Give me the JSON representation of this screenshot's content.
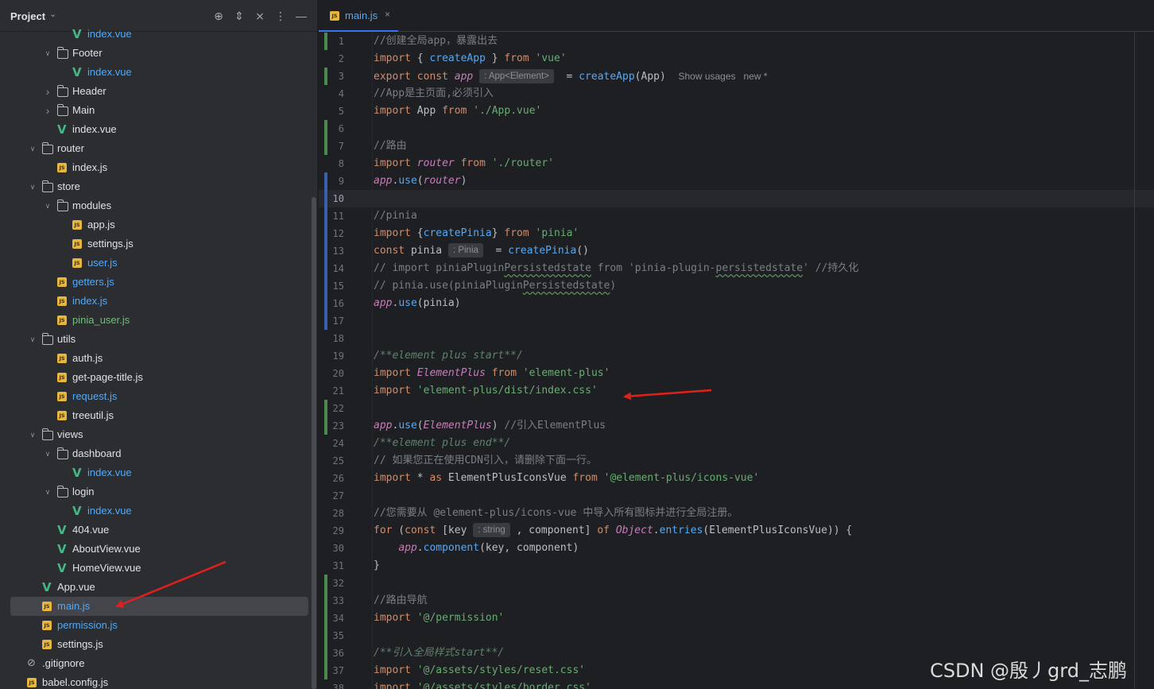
{
  "project_panel": {
    "title": "Project",
    "toolbar": [
      "locate-icon",
      "expand-collapse-icon",
      "collapse-all-icon",
      "more-icon",
      "minimize-icon"
    ],
    "tree": [
      {
        "label": "index.vue",
        "type": "vue",
        "indent": 5,
        "color": "blue"
      },
      {
        "label": "Footer",
        "type": "folder",
        "indent": 4,
        "expanded": true
      },
      {
        "label": "index.vue",
        "type": "vue",
        "indent": 5,
        "color": "blue"
      },
      {
        "label": "Header",
        "type": "folder",
        "indent": 4,
        "expanded": false
      },
      {
        "label": "Main",
        "type": "folder",
        "indent": 4,
        "expanded": false
      },
      {
        "label": "index.vue",
        "type": "vue",
        "indent": 4,
        "color": "default"
      },
      {
        "label": "router",
        "type": "folder",
        "indent": 3,
        "expanded": true
      },
      {
        "label": "index.js",
        "type": "js",
        "indent": 4,
        "color": "default"
      },
      {
        "label": "store",
        "type": "folder",
        "indent": 3,
        "expanded": true
      },
      {
        "label": "modules",
        "type": "folder",
        "indent": 4,
        "expanded": true
      },
      {
        "label": "app.js",
        "type": "js",
        "indent": 5,
        "color": "default"
      },
      {
        "label": "settings.js",
        "type": "js",
        "indent": 5,
        "color": "default"
      },
      {
        "label": "user.js",
        "type": "js",
        "indent": 5,
        "color": "blue"
      },
      {
        "label": "getters.js",
        "type": "js",
        "indent": 4,
        "color": "blue"
      },
      {
        "label": "index.js",
        "type": "js",
        "indent": 4,
        "color": "blue"
      },
      {
        "label": "pinia_user.js",
        "type": "js",
        "indent": 4,
        "color": "green"
      },
      {
        "label": "utils",
        "type": "folder",
        "indent": 3,
        "expanded": true
      },
      {
        "label": "auth.js",
        "type": "js",
        "indent": 4,
        "color": "default"
      },
      {
        "label": "get-page-title.js",
        "type": "js",
        "indent": 4,
        "color": "default"
      },
      {
        "label": "request.js",
        "type": "js",
        "indent": 4,
        "color": "blue"
      },
      {
        "label": "treeutil.js",
        "type": "js",
        "indent": 4,
        "color": "default"
      },
      {
        "label": "views",
        "type": "folder",
        "indent": 3,
        "expanded": true
      },
      {
        "label": "dashboard",
        "type": "folder",
        "indent": 4,
        "expanded": true
      },
      {
        "label": "index.vue",
        "type": "vue",
        "indent": 5,
        "color": "blue"
      },
      {
        "label": "login",
        "type": "folder",
        "indent": 4,
        "expanded": true
      },
      {
        "label": "index.vue",
        "type": "vue",
        "indent": 5,
        "color": "blue"
      },
      {
        "label": "404.vue",
        "type": "vue",
        "indent": 4,
        "color": "default"
      },
      {
        "label": "AboutView.vue",
        "type": "vue",
        "indent": 4,
        "color": "default"
      },
      {
        "label": "HomeView.vue",
        "type": "vue",
        "indent": 4,
        "color": "default"
      },
      {
        "label": "App.vue",
        "type": "vue",
        "indent": 3,
        "color": "default"
      },
      {
        "label": "main.js",
        "type": "js",
        "indent": 3,
        "color": "blue",
        "selected": true
      },
      {
        "label": "permission.js",
        "type": "js",
        "indent": 3,
        "color": "blue"
      },
      {
        "label": "settings.js",
        "type": "js",
        "indent": 3,
        "color": "default"
      },
      {
        "label": ".gitignore",
        "type": "ignore",
        "indent": 2,
        "color": "default"
      },
      {
        "label": "babel.config.js",
        "type": "js",
        "indent": 2,
        "color": "default"
      }
    ]
  },
  "editor": {
    "tab": {
      "label": "main.js",
      "icon": "js-file-icon",
      "close": "×"
    },
    "current_line": 10,
    "lines": [
      [
        [
          "cmt",
          "//创建全局app，暴露出去"
        ]
      ],
      [
        [
          "kw",
          "import"
        ],
        [
          "dim",
          " { "
        ],
        [
          "fn",
          "createApp"
        ],
        [
          "dim",
          " } "
        ],
        [
          "kw",
          "from"
        ],
        [
          "dim",
          " "
        ],
        [
          "str",
          "'vue'"
        ]
      ],
      [
        [
          "kw",
          "export const"
        ],
        [
          "dim",
          " "
        ],
        [
          "glob",
          "app"
        ],
        [
          "dim",
          " "
        ],
        [
          "hint",
          ": App<Element>"
        ],
        [
          "dim",
          "  = "
        ],
        [
          "fn",
          "createApp"
        ],
        [
          "dim",
          "(App)  "
        ],
        [
          "usage",
          "Show usages   new *"
        ]
      ],
      [
        [
          "cmt",
          "//App是主页面,必须引入"
        ]
      ],
      [
        [
          "kw",
          "import"
        ],
        [
          "dim",
          " App "
        ],
        [
          "kw",
          "from"
        ],
        [
          "dim",
          " "
        ],
        [
          "str",
          "'./App.vue'"
        ]
      ],
      [],
      [
        [
          "cmt",
          "//路由"
        ]
      ],
      [
        [
          "kw",
          "import"
        ],
        [
          "dim",
          " "
        ],
        [
          "glob",
          "router"
        ],
        [
          "dim",
          " "
        ],
        [
          "kw",
          "from"
        ],
        [
          "dim",
          " "
        ],
        [
          "str",
          "'./router'"
        ]
      ],
      [
        [
          "glob",
          "app"
        ],
        [
          "dim",
          "."
        ],
        [
          "fn",
          "use"
        ],
        [
          "dim",
          "("
        ],
        [
          "glob",
          "router"
        ],
        [
          "dim",
          ")"
        ]
      ],
      [],
      [
        [
          "cmt",
          "//pinia"
        ]
      ],
      [
        [
          "kw",
          "import"
        ],
        [
          "dim",
          " {"
        ],
        [
          "fn",
          "createPinia"
        ],
        [
          "dim",
          "} "
        ],
        [
          "kw",
          "from"
        ],
        [
          "dim",
          " "
        ],
        [
          "str",
          "'pinia'"
        ]
      ],
      [
        [
          "kw",
          "const"
        ],
        [
          "dim",
          " pinia "
        ],
        [
          "hint",
          ": Pinia"
        ],
        [
          "dim",
          "  = "
        ],
        [
          "fn",
          "createPinia"
        ],
        [
          "dim",
          "()"
        ]
      ],
      [
        [
          "cmt",
          "// import piniaPlugin"
        ],
        [
          "cmtw",
          "Persistedstate"
        ],
        [
          "cmt",
          " from 'pinia-plugin-"
        ],
        [
          "cmtw",
          "persistedstate"
        ],
        [
          "cmt",
          "' //持久化"
        ]
      ],
      [
        [
          "cmt",
          "// pinia.use(piniaPlugin"
        ],
        [
          "cmtw",
          "Persistedstate"
        ],
        [
          "cmt",
          ")"
        ]
      ],
      [
        [
          "glob",
          "app"
        ],
        [
          "dim",
          "."
        ],
        [
          "fn",
          "use"
        ],
        [
          "dim",
          "(pinia)"
        ]
      ],
      [],
      [],
      [
        [
          "doc",
          "/**element plus start**/"
        ]
      ],
      [
        [
          "kw",
          "import"
        ],
        [
          "dim",
          " "
        ],
        [
          "cls",
          "ElementPlus"
        ],
        [
          "dim",
          " "
        ],
        [
          "kw",
          "from"
        ],
        [
          "dim",
          " "
        ],
        [
          "str",
          "'element-plus'"
        ]
      ],
      [
        [
          "kw",
          "import"
        ],
        [
          "dim",
          " "
        ],
        [
          "str",
          "'element-plus/dist/index.css'"
        ]
      ],
      [],
      [
        [
          "glob",
          "app"
        ],
        [
          "dim",
          "."
        ],
        [
          "fn",
          "use"
        ],
        [
          "dim",
          "("
        ],
        [
          "cls",
          "ElementPlus"
        ],
        [
          "dim",
          ") "
        ],
        [
          "cmt",
          "//引入ElementPlus"
        ]
      ],
      [
        [
          "doc",
          "/**element plus end**/"
        ]
      ],
      [
        [
          "cmt",
          "// 如果您正在使用CDN引入，请删除下面一行。"
        ]
      ],
      [
        [
          "kw",
          "import"
        ],
        [
          "dim",
          " * "
        ],
        [
          "kw",
          "as"
        ],
        [
          "dim",
          " ElementPlusIconsVue "
        ],
        [
          "kw",
          "from"
        ],
        [
          "dim",
          " "
        ],
        [
          "str",
          "'@element-plus/icons-vue'"
        ]
      ],
      [],
      [
        [
          "cmt",
          "//您需要从 @element-plus/icons-vue 中导入所有图标并进行全局注册。"
        ]
      ],
      [
        [
          "kw",
          "for"
        ],
        [
          "dim",
          " ("
        ],
        [
          "kw",
          "const"
        ],
        [
          "dim",
          " [key "
        ],
        [
          "hint",
          ": string"
        ],
        [
          "dim",
          " , component] "
        ],
        [
          "kw",
          "of"
        ],
        [
          "dim",
          " "
        ],
        [
          "cls",
          "Object"
        ],
        [
          "dim",
          "."
        ],
        [
          "fn",
          "entries"
        ],
        [
          "dim",
          "(ElementPlusIconsVue)) {"
        ]
      ],
      [
        [
          "dim",
          "    "
        ],
        [
          "glob",
          "app"
        ],
        [
          "dim",
          "."
        ],
        [
          "fn",
          "component"
        ],
        [
          "dim",
          "(key, component)"
        ]
      ],
      [
        [
          "dim",
          "}"
        ]
      ],
      [],
      [
        [
          "cmt",
          "//路由导航"
        ]
      ],
      [
        [
          "kw",
          "import"
        ],
        [
          "dim",
          " "
        ],
        [
          "str",
          "'@/permission'"
        ]
      ],
      [],
      [
        [
          "doc",
          "/**引入全局样式start**/"
        ]
      ],
      [
        [
          "kw",
          "import"
        ],
        [
          "dim",
          " "
        ],
        [
          "str",
          "'@/assets/styles/reset.css'"
        ]
      ],
      [
        [
          "kw",
          "import"
        ],
        [
          "dim",
          " "
        ],
        [
          "str",
          "'@/assets/styles/border.css'"
        ]
      ]
    ]
  },
  "watermark": "CSDN @殷丿grd_志鹏"
}
